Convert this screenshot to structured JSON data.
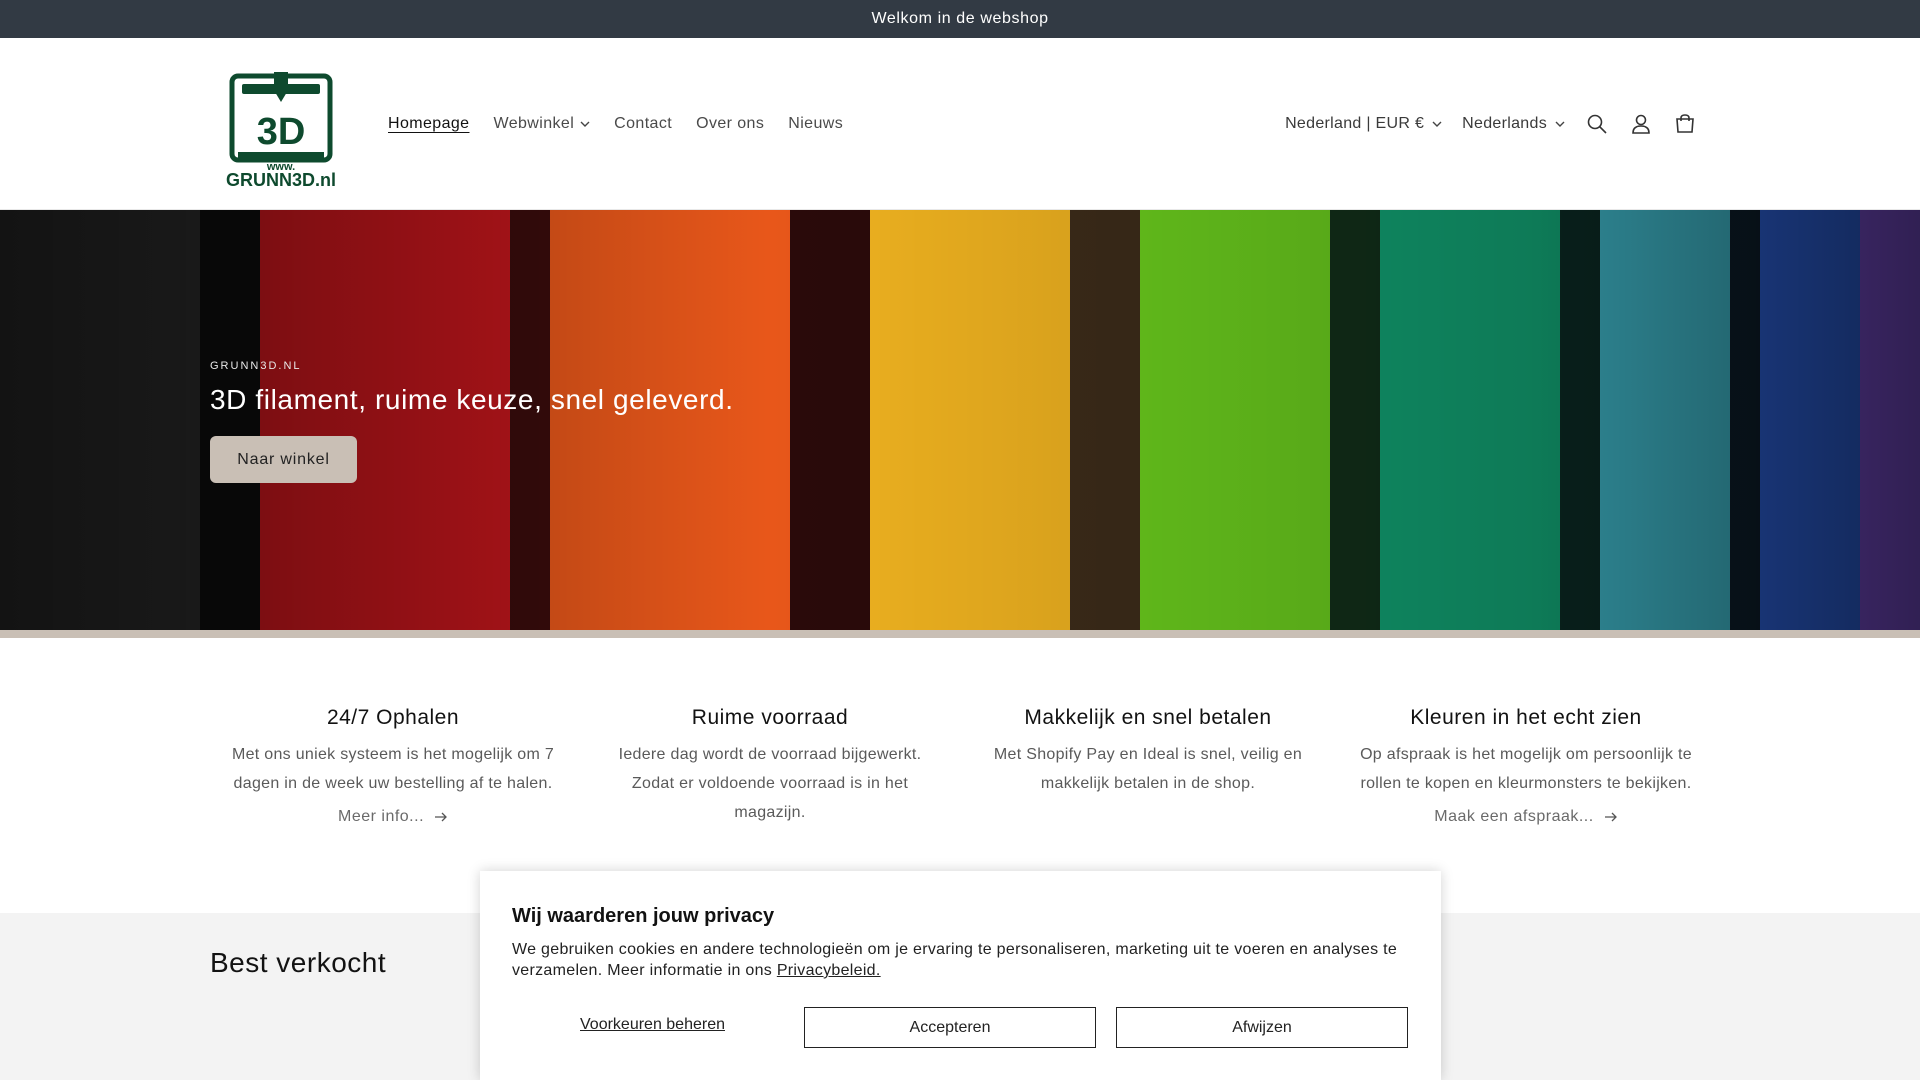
{
  "announcement": {
    "text": "Welkom in de webshop"
  },
  "brand": {
    "logo_top": "3D",
    "logo_www": "www.",
    "logo_name": "GRUNN3D.nl",
    "logo_color": "#0e4a2e"
  },
  "nav": {
    "items": [
      {
        "label": "Homepage",
        "active": true
      },
      {
        "label": "Webwinkel",
        "dropdown": true
      },
      {
        "label": "Contact"
      },
      {
        "label": "Over ons"
      },
      {
        "label": "Nieuws"
      }
    ]
  },
  "header_right": {
    "country": "Nederland | EUR €",
    "language": "Nederlands",
    "icons": [
      "search-icon",
      "account-icon",
      "cart-icon"
    ]
  },
  "hero": {
    "kicker": "GRUNN3D.NL",
    "title": "3D filament, ruime keuze, snel geleverd.",
    "button": "Naar winkel",
    "accent": "#c9bfb5"
  },
  "features": [
    {
      "title": "24/7 Ophalen",
      "text": "Met ons uniek systeem is het mogelijk om 7 dagen in de week uw bestelling af te halen.",
      "link": "Meer info..."
    },
    {
      "title": "Ruime voorraad",
      "text": "Iedere dag wordt de voorraad bijgewerkt. Zodat er voldoende voorraad is in het magazijn.",
      "link": ""
    },
    {
      "title": "Makkelijk en snel betalen",
      "text": "Met Shopify Pay en Ideal is snel, veilig en makkelijk betalen in de shop.",
      "link": ""
    },
    {
      "title": "Kleuren in het echt zien",
      "text": "Op afspraak is het mogelijk om persoonlijk te rollen te kopen en kleurmonsters te bekijken.",
      "link": "Maak een afspraak..."
    }
  ],
  "best": {
    "title": "Best verkocht"
  },
  "privacy": {
    "title": "Wij waarderen jouw privacy",
    "text": "We gebruiken cookies en andere technologieën om je ervaring te personaliseren, marketing uit te voeren en analyses te verzamelen. Meer informatie in ons ",
    "link": "Privacybeleid.",
    "manage": "Voorkeuren beheren",
    "accept": "Accepteren",
    "decline": "Afwijzen"
  }
}
